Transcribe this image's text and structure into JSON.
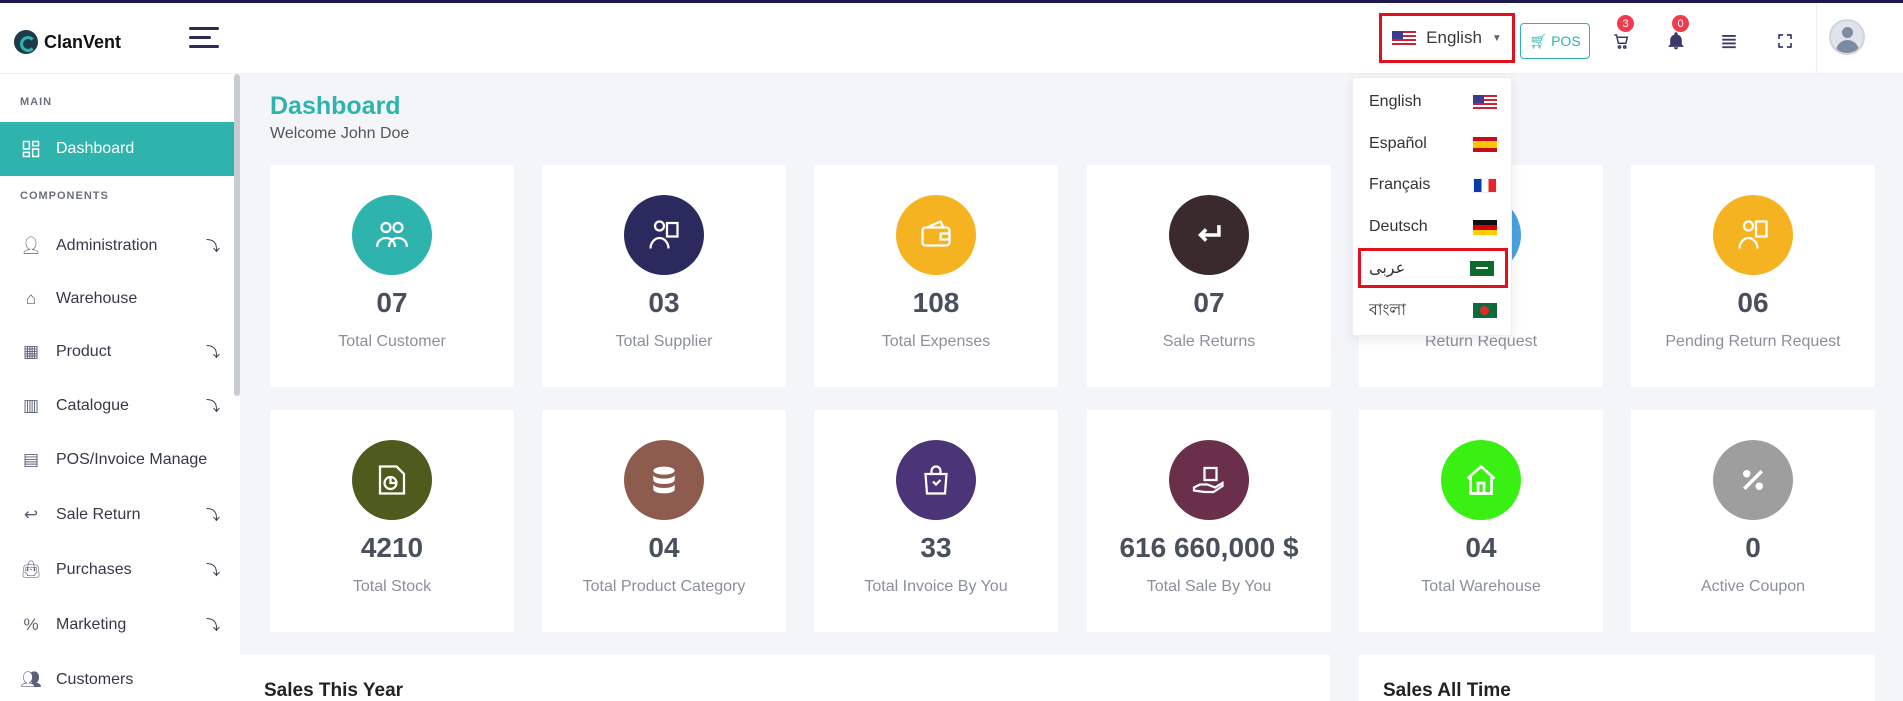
{
  "brand": {
    "name": "ClanVent"
  },
  "header": {
    "language": "English",
    "pos_label": "POS",
    "cart_count": "3",
    "notifications_count": "0"
  },
  "sidebar": {
    "section_main": "MAIN",
    "section_components": "COMPONENTS",
    "items": [
      {
        "label": "Dashboard",
        "icon": "dashboard-icon",
        "active": true
      },
      {
        "label": "Administration",
        "icon": "users-icon",
        "submenu": true
      },
      {
        "label": "Warehouse",
        "icon": "home-icon"
      },
      {
        "label": "Product",
        "icon": "box-icon",
        "submenu": true
      },
      {
        "label": "Catalogue",
        "icon": "catalogue-icon",
        "submenu": true
      },
      {
        "label": "POS/Invoice Manage",
        "icon": "invoice-icon"
      },
      {
        "label": "Sale Return",
        "icon": "return-icon",
        "submenu": true
      },
      {
        "label": "Purchases",
        "icon": "bag-icon",
        "submenu": true
      },
      {
        "label": "Marketing",
        "icon": "percent-icon",
        "submenu": true
      },
      {
        "label": "Customers",
        "icon": "customers-icon"
      }
    ]
  },
  "main": {
    "title": "Dashboard",
    "welcome": "Welcome John Doe",
    "cards": [
      {
        "value": "07",
        "label": "Total Customer",
        "color": "#2fb3ad",
        "icon": "customers-icon"
      },
      {
        "value": "03",
        "label": "Total Supplier",
        "color": "#2b2a5e",
        "icon": "supplier-icon"
      },
      {
        "value": "108",
        "label": "Total Expenses",
        "color": "#f6b321",
        "icon": "wallet-icon"
      },
      {
        "value": "07",
        "label": "Sale Returns",
        "color": "#3b2a2d",
        "icon": "return-arrow-icon"
      },
      {
        "value": "",
        "label": "Return Request",
        "color": "#4aa3e0",
        "icon": "request-icon"
      },
      {
        "value": "06",
        "label": "Pending Return Request",
        "color": "#f6b321",
        "icon": "pending-icon"
      },
      {
        "value": "4210",
        "label": "Total Stock",
        "color": "#4f5a1d",
        "icon": "stock-icon"
      },
      {
        "value": "04",
        "label": "Total Product Category",
        "color": "#8e5c4e",
        "icon": "database-icon"
      },
      {
        "value": "33",
        "label": "Total Invoice By You",
        "color": "#4b3477",
        "icon": "shopping-bag-icon"
      },
      {
        "value": "616 660,000 $",
        "label": "Total Sale By You",
        "color": "#6a2f4a",
        "icon": "sale-hand-icon"
      },
      {
        "value": "04",
        "label": "Total Warehouse",
        "color": "#3af012",
        "icon": "warehouse-icon"
      },
      {
        "value": "0",
        "label": "Active Coupon",
        "color": "#9e9e9e",
        "icon": "percent-icon"
      }
    ],
    "panels": [
      {
        "title": "Sales This Year"
      },
      {
        "title": "Sales All Time"
      }
    ]
  },
  "language_menu": [
    {
      "label": "English",
      "flag": "flag-us"
    },
    {
      "label": "Español",
      "flag": "flag-es"
    },
    {
      "label": "Français",
      "flag": "flag-fr"
    },
    {
      "label": "Deutsch",
      "flag": "flag-de"
    },
    {
      "label": "عربى",
      "flag": "flag-sa",
      "highlighted": true
    },
    {
      "label": "বাংলা",
      "flag": "flag-bd"
    }
  ]
}
